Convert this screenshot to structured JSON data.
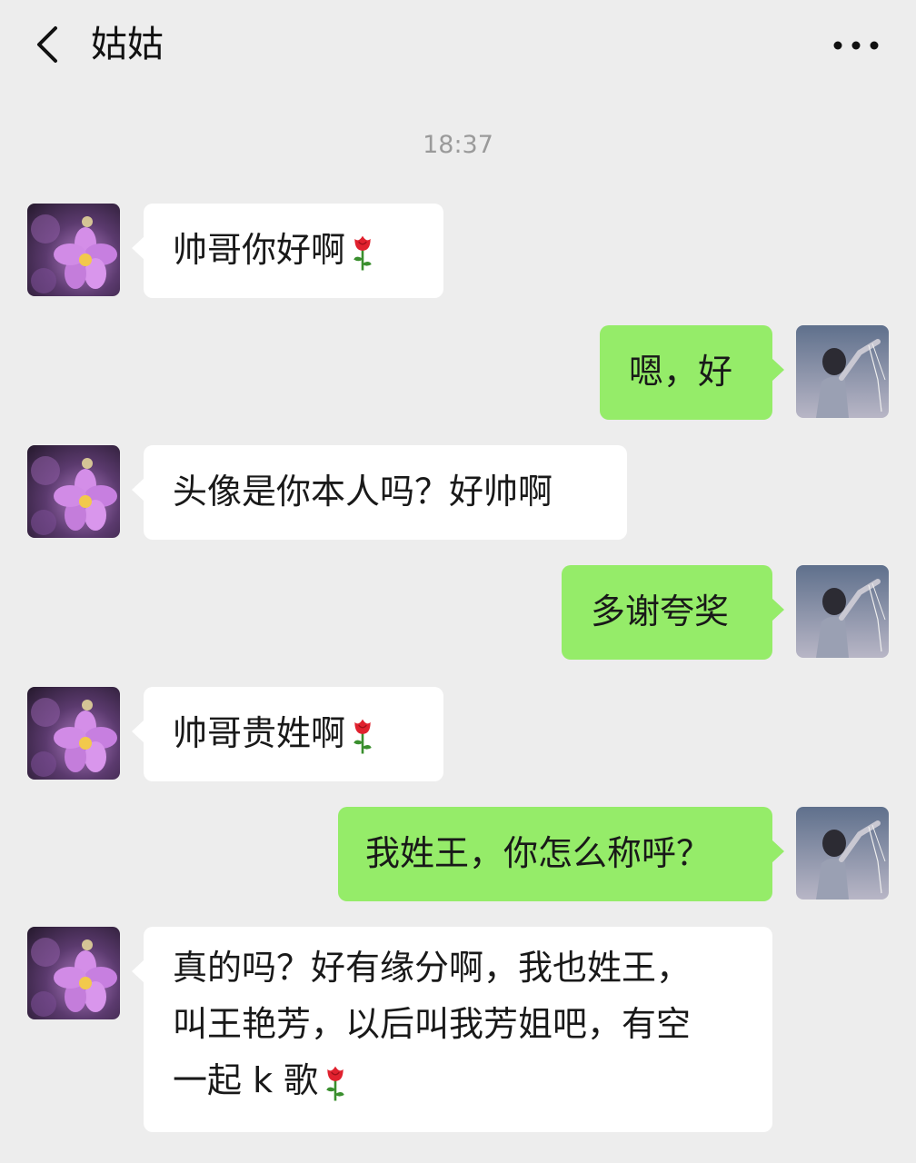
{
  "header": {
    "title": "姑姑",
    "back_icon": "chevron-left-icon",
    "more_icon": "more-dots-icon"
  },
  "timestamp": "18:37",
  "emoji": "rose-icon",
  "colors": {
    "background": "#ededed",
    "incoming_bubble": "#ffffff",
    "outgoing_bubble": "#95ec69"
  },
  "messages": [
    {
      "sender": "them",
      "text": "帅哥你好啊",
      "emoji": "rose"
    },
    {
      "sender": "me",
      "text": "嗯，好"
    },
    {
      "sender": "them",
      "text": "头像是你本人吗？好帅啊"
    },
    {
      "sender": "me",
      "text": "多谢夸奖"
    },
    {
      "sender": "them",
      "text": "帅哥贵姓啊",
      "emoji": "rose"
    },
    {
      "sender": "me",
      "text": "我姓王，你怎么称呼？"
    },
    {
      "sender": "them",
      "lines": [
        "真的吗？好有缘分啊，我也姓王，",
        "叫王艳芳，以后叫我芳姐吧，有空",
        "一起 k 歌"
      ],
      "emoji": "rose"
    }
  ]
}
